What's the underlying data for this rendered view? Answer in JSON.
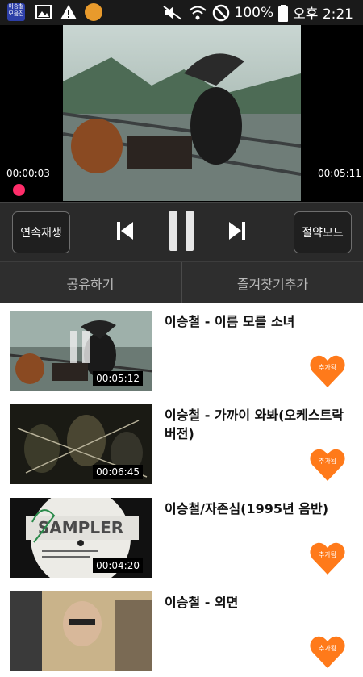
{
  "status_bar": {
    "app_icon_text": "이승철",
    "app_icon_subtext": "모음집",
    "battery": "100%",
    "time": "오후 2:21"
  },
  "player": {
    "elapsed": "00:00:03",
    "total": "00:05:11"
  },
  "controls": {
    "continuous_label": "연속재생",
    "saver_label": "절약모드"
  },
  "actions": {
    "share_label": "공유하기",
    "favorite_label": "즐겨찾기추가"
  },
  "playlist": [
    {
      "title": "이승철 - 이름 모를 소녀",
      "duration": "00:05:12",
      "badge": "추가됨"
    },
    {
      "title": "이승철 - 가까이 와봐(오케스트락 버전)",
      "duration": "00:06:45",
      "badge": "추가됨"
    },
    {
      "title": "이승철/자존심(1995년 음반)",
      "duration": "00:04:20",
      "badge": "추가됨"
    },
    {
      "title": "이승철 - 외면",
      "duration": "",
      "badge": "추가됨"
    }
  ],
  "colors": {
    "accent_orange": "#ff7a1a",
    "progress_pink": "#ff2d6a"
  }
}
